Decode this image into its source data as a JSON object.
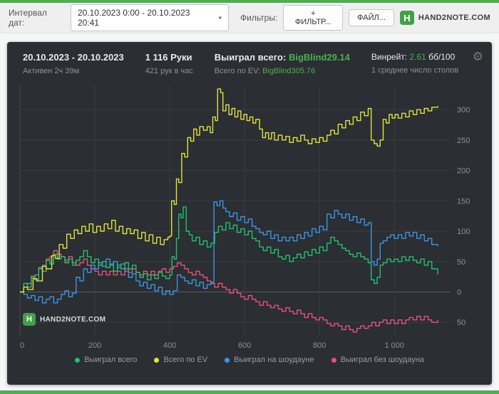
{
  "window": {
    "accent_color": "#4caf50",
    "panel_bg": "#2b2e33"
  },
  "toolbar": {
    "interval_label": "Интервал дат:",
    "date_range": "20.10.2023 0:00 - 20.10.2023 20:41",
    "filters_label": "Фильтры:",
    "filter_button": "+ ФИЛЬТР...",
    "file_button": "ФАЙЛ...",
    "brand": "HAND2NOTE.COM"
  },
  "stats": {
    "date_range": "20.10.2023 - 20.10.2023",
    "active": "Активен 2ч 39м",
    "hands": "1 116 Руки",
    "hands_rate": "421 рук в час",
    "won_label": "Выиграл всего:",
    "won_value": "BigBlind29.14",
    "ev_label": "Всего по EV:",
    "ev_value": "BigBlind305.76",
    "winrate_label": "Винрейт:",
    "winrate_value": "2.61",
    "winrate_unit": "бб/100",
    "tables": "1 среднее число столов"
  },
  "watermark": "HAND2NOTE.COM",
  "icons": {
    "gear": "⚙",
    "caret": "▾",
    "logo_letter": "H"
  },
  "chart_data": {
    "type": "line",
    "title": "",
    "xlabel": "",
    "ylabel": "",
    "x_range": [
      0,
      1150
    ],
    "y_range": [
      -72,
      340
    ],
    "grid": true,
    "step": true,
    "legend_position": "bottom",
    "x_ticks": [
      {
        "v": 0,
        "label": "0"
      },
      {
        "v": 200,
        "label": "200"
      },
      {
        "v": 400,
        "label": "400"
      },
      {
        "v": 600,
        "label": "600"
      },
      {
        "v": 800,
        "label": "800"
      },
      {
        "v": 1000,
        "label": "1 000"
      }
    ],
    "y_ticks": [
      {
        "v": 300,
        "label": "300"
      },
      {
        "v": 250,
        "label": "250"
      },
      {
        "v": 200,
        "label": "200"
      },
      {
        "v": 150,
        "label": "150"
      },
      {
        "v": 100,
        "label": "100"
      },
      {
        "v": 50,
        "label": "50"
      },
      {
        "v": 0,
        "label": "0"
      },
      {
        "v": -50,
        "label": "50"
      }
    ],
    "draw_order": [
      3,
      2,
      0,
      1
    ],
    "series": [
      {
        "name": "Выиграл всего",
        "color": "#1fc46c",
        "final_value": 29.14,
        "points": [
          0,
          0,
          10,
          14,
          20,
          8,
          30,
          26,
          40,
          20,
          50,
          40,
          60,
          34,
          70,
          52,
          80,
          46,
          90,
          62,
          100,
          54,
          110,
          58,
          120,
          48,
          130,
          54,
          140,
          44,
          150,
          52,
          160,
          58,
          170,
          68,
          180,
          58,
          190,
          48,
          200,
          54,
          210,
          44,
          220,
          50,
          230,
          40,
          240,
          46,
          250,
          34,
          260,
          44,
          270,
          38,
          280,
          48,
          290,
          38,
          300,
          44,
          310,
          32,
          320,
          24,
          330,
          30,
          340,
          20,
          350,
          28,
          360,
          22,
          370,
          32,
          380,
          26,
          390,
          22,
          400,
          28,
          406,
          58,
          412,
          54,
          418,
          88,
          424,
          128,
          430,
          122,
          436,
          140,
          444,
          100,
          452,
          94,
          460,
          84,
          470,
          90,
          480,
          78,
          490,
          84,
          500,
          74,
          510,
          80,
          520,
          98,
          530,
          108,
          540,
          102,
          550,
          114,
          560,
          104,
          570,
          110,
          580,
          98,
          590,
          104,
          600,
          94,
          610,
          100,
          620,
          88,
          630,
          84,
          640,
          74,
          650,
          68,
          660,
          74,
          670,
          64,
          680,
          70,
          690,
          58,
          700,
          54,
          710,
          60,
          720,
          50,
          730,
          56,
          740,
          62,
          750,
          56,
          760,
          66,
          770,
          60,
          780,
          70,
          790,
          64,
          800,
          74,
          810,
          68,
          820,
          80,
          830,
          90,
          840,
          84,
          850,
          78,
          860,
          72,
          870,
          68,
          880,
          62,
          890,
          58,
          900,
          64,
          910,
          58,
          920,
          54,
          930,
          48,
          938,
          20,
          946,
          14,
          954,
          24,
          962,
          44,
          970,
          48,
          980,
          54,
          990,
          50,
          1000,
          54,
          1010,
          50,
          1020,
          58,
          1030,
          52,
          1040,
          58,
          1050,
          52,
          1060,
          48,
          1070,
          54,
          1080,
          44,
          1090,
          50,
          1100,
          38,
          1116,
          29
        ]
      },
      {
        "name": "Всего по EV",
        "color": "#e2e438",
        "final_value": 305.76,
        "points": [
          0,
          0,
          10,
          8,
          20,
          4,
          35,
          22,
          45,
          18,
          60,
          42,
          70,
          38,
          85,
          60,
          95,
          55,
          105,
          78,
          115,
          72,
          125,
          95,
          135,
          88,
          145,
          102,
          155,
          96,
          165,
          108,
          175,
          100,
          185,
          112,
          195,
          98,
          205,
          108,
          215,
          100,
          225,
          112,
          235,
          104,
          245,
          118,
          255,
          100,
          265,
          108,
          275,
          96,
          285,
          104,
          295,
          96,
          305,
          102,
          315,
          88,
          325,
          98,
          335,
          84,
          345,
          94,
          355,
          80,
          365,
          90,
          375,
          78,
          385,
          86,
          395,
          90,
          400,
          92,
          405,
          150,
          412,
          144,
          418,
          186,
          424,
          180,
          432,
          228,
          440,
          222,
          448,
          254,
          456,
          248,
          464,
          268,
          472,
          258,
          480,
          272,
          490,
          266,
          500,
          272,
          508,
          262,
          515,
          288,
          522,
          282,
          528,
          334,
          536,
          328,
          542,
          298,
          550,
          308,
          558,
          292,
          566,
          302,
          574,
          288,
          582,
          298,
          590,
          284,
          598,
          292,
          606,
          282,
          614,
          288,
          622,
          278,
          630,
          284,
          640,
          268,
          648,
          254,
          656,
          262,
          664,
          252,
          672,
          262,
          680,
          250,
          690,
          258,
          700,
          250,
          710,
          256,
          720,
          246,
          730,
          254,
          740,
          248,
          750,
          258,
          760,
          250,
          770,
          244,
          780,
          252,
          790,
          246,
          800,
          254,
          810,
          248,
          820,
          258,
          830,
          266,
          840,
          260,
          850,
          276,
          860,
          270,
          870,
          282,
          880,
          276,
          890,
          288,
          900,
          282,
          910,
          296,
          920,
          290,
          930,
          302,
          938,
          250,
          946,
          244,
          954,
          240,
          962,
          250,
          970,
          284,
          978,
          278,
          986,
          292,
          994,
          286,
          1002,
          292,
          1010,
          286,
          1020,
          294,
          1030,
          288,
          1040,
          298,
          1050,
          292,
          1060,
          300,
          1070,
          294,
          1080,
          302,
          1090,
          298,
          1100,
          304,
          1116,
          306
        ]
      },
      {
        "name": "Выиграл на шоудауне",
        "color": "#3b96e8",
        "points": [
          0,
          0,
          10,
          -4,
          20,
          -10,
          30,
          -6,
          40,
          -14,
          50,
          -8,
          60,
          -18,
          70,
          -12,
          80,
          -8,
          90,
          -18,
          100,
          -12,
          110,
          -4,
          120,
          2,
          130,
          -8,
          140,
          -2,
          150,
          24,
          160,
          18,
          170,
          38,
          180,
          32,
          190,
          44,
          200,
          38,
          210,
          48,
          220,
          42,
          230,
          54,
          240,
          44,
          250,
          50,
          260,
          40,
          270,
          46,
          280,
          34,
          290,
          24,
          300,
          30,
          310,
          18,
          320,
          10,
          330,
          16,
          340,
          6,
          350,
          12,
          360,
          2,
          370,
          8,
          380,
          -4,
          390,
          2,
          400,
          -4,
          410,
          2,
          420,
          28,
          430,
          24,
          440,
          18,
          450,
          14,
          460,
          20,
          470,
          10,
          480,
          16,
          490,
          6,
          500,
          12,
          510,
          16,
          518,
          148,
          526,
          142,
          534,
          150,
          542,
          138,
          550,
          132,
          560,
          124,
          570,
          130,
          580,
          118,
          590,
          124,
          600,
          114,
          610,
          120,
          620,
          108,
          630,
          104,
          640,
          98,
          650,
          94,
          660,
          100,
          670,
          88,
          680,
          94,
          690,
          84,
          700,
          90,
          710,
          84,
          720,
          90,
          730,
          84,
          740,
          94,
          750,
          88,
          760,
          98,
          770,
          92,
          780,
          104,
          790,
          98,
          800,
          108,
          810,
          102,
          820,
          128,
          830,
          122,
          840,
          134,
          850,
          128,
          860,
          122,
          870,
          128,
          880,
          118,
          890,
          124,
          900,
          114,
          910,
          120,
          920,
          110,
          930,
          114,
          938,
          50,
          946,
          44,
          954,
          54,
          962,
          80,
          970,
          84,
          980,
          90,
          990,
          94,
          1000,
          88,
          1010,
          94,
          1020,
          88,
          1030,
          98,
          1040,
          92,
          1050,
          98,
          1060,
          88,
          1070,
          94,
          1080,
          84,
          1090,
          88,
          1100,
          78,
          1116,
          75
        ]
      },
      {
        "name": "Выиграл без шоудауна",
        "color": "#e8517e",
        "points": [
          0,
          0,
          10,
          8,
          20,
          14,
          30,
          24,
          40,
          28,
          50,
          38,
          60,
          44,
          70,
          54,
          80,
          58,
          90,
          68,
          100,
          62,
          110,
          58,
          120,
          52,
          130,
          58,
          140,
          48,
          150,
          44,
          160,
          48,
          170,
          54,
          180,
          44,
          190,
          38,
          200,
          34,
          210,
          28,
          220,
          34,
          230,
          28,
          240,
          34,
          250,
          28,
          260,
          34,
          270,
          28,
          280,
          38,
          290,
          32,
          300,
          38,
          310,
          32,
          320,
          28,
          330,
          34,
          340,
          28,
          350,
          34,
          360,
          28,
          370,
          34,
          380,
          38,
          390,
          32,
          400,
          38,
          410,
          42,
          420,
          48,
          430,
          44,
          440,
          38,
          450,
          32,
          460,
          28,
          470,
          34,
          480,
          28,
          490,
          24,
          500,
          18,
          510,
          14,
          520,
          8,
          530,
          14,
          540,
          8,
          550,
          4,
          560,
          -2,
          570,
          4,
          580,
          -2,
          590,
          -8,
          600,
          -12,
          610,
          -6,
          620,
          -12,
          630,
          -16,
          640,
          -22,
          650,
          -16,
          660,
          -22,
          670,
          -26,
          680,
          -22,
          690,
          -28,
          700,
          -32,
          710,
          -26,
          720,
          -32,
          730,
          -36,
          740,
          -30,
          750,
          -36,
          760,
          -42,
          770,
          -36,
          780,
          -42,
          790,
          -46,
          800,
          -42,
          810,
          -46,
          820,
          -52,
          830,
          -56,
          840,
          -52,
          850,
          -56,
          860,
          -62,
          870,
          -56,
          880,
          -62,
          890,
          -66,
          900,
          -60,
          910,
          -56,
          920,
          -60,
          930,
          -56,
          940,
          -50,
          950,
          -56,
          960,
          -50,
          970,
          -46,
          980,
          -52,
          990,
          -46,
          1000,
          -52,
          1010,
          -46,
          1020,
          -52,
          1030,
          -46,
          1040,
          -42,
          1050,
          -46,
          1060,
          -40,
          1070,
          -46,
          1080,
          -40,
          1090,
          -46,
          1100,
          -50,
          1116,
          -46
        ]
      }
    ]
  }
}
